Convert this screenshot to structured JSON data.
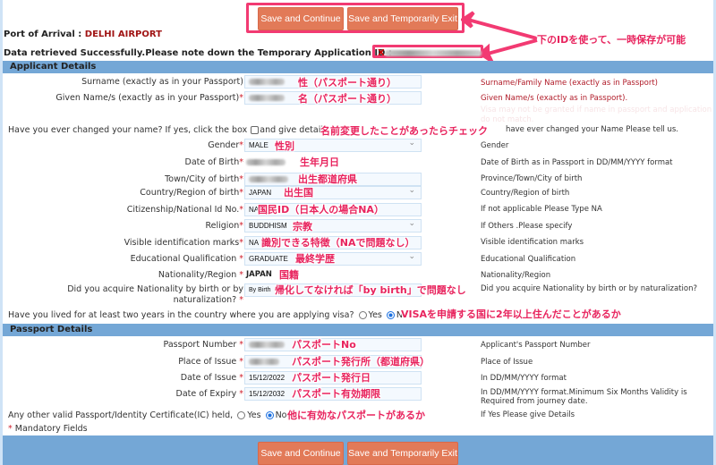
{
  "top_buttons": {
    "save_continue": "Save and Continue",
    "save_exit": "Save and Temporarily Exit"
  },
  "header": {
    "port_label": "Port of Arrival : ",
    "port_value": "DELHI AIRPORT",
    "retrieved_text": "Data retrieved Successfully.Please note down the Temporary Application ID : ",
    "app_id_prefix": "X"
  },
  "annotations": {
    "id_note": "下のIDを使って、一時保存が可能",
    "surname": "性（パスポート通り）",
    "given": "名（パスポート通り）",
    "name_change": "名前変更したことがあったらチェック",
    "gender": "性別",
    "dob": "生年月日",
    "town": "出生都道府県",
    "country": "出生国",
    "national_id": "国民ID（日本人の場合NA）",
    "religion": "宗教",
    "marks": "識別できる特徴（NAで問題なし）",
    "education": "最終学歴",
    "nationality": "国籍",
    "acquire": "帰化してなければ「by birth」で問題なし",
    "lived": "VISAを申請する国に2年以上住んだことがあるか",
    "passport_no": "パスポートNo",
    "place_issue": "パスポート発行所（都道府県）",
    "date_issue": "パスポート発行日",
    "date_expiry": "パスポート有効期限",
    "other_passport": "他に有効なパスポートがあるか"
  },
  "applicant": {
    "title": "Applicant Details",
    "surname": {
      "label": "Surname (exactly as in your Passport)",
      "hint": "Surname/Family Name (exactly as in Passport)"
    },
    "given": {
      "label": "Given Name/s (exactly as in your Passport)",
      "hint": "Given Name/s (exactly as in Passport).",
      "hint2": "Visa may not be granted if name in passport and application",
      "hint3": "do not match."
    },
    "name_change": {
      "label": "Have you ever changed your name? If yes, click the box",
      "after": "and give details",
      "hint": "have ever changed your Name Please tell us."
    },
    "gender": {
      "label": "Gender",
      "value": "MALE",
      "hint": "Gender"
    },
    "dob": {
      "label": "Date of Birth",
      "hint": "Date of Birth as in Passport in DD/MM/YYYY format"
    },
    "town": {
      "label": "Town/City of birth",
      "hint": "Province/Town/City of birth"
    },
    "country": {
      "label": "Country/Region of birth",
      "value": "JAPAN",
      "hint": "Country/Region of birth"
    },
    "national_id": {
      "label": "Citizenship/National Id No.",
      "value": "NA",
      "hint": "If not applicable Please Type NA"
    },
    "religion": {
      "label": "Religion",
      "value": "BUDDHISM",
      "hint": "If Others .Please specify"
    },
    "marks": {
      "label": "Visible identification marks",
      "value": "NA",
      "hint": "Visible identification marks"
    },
    "education": {
      "label": "Educational Qualification ",
      "value": "GRADUATE",
      "hint": "Educational Qualification"
    },
    "nationality": {
      "label": "Nationality/Region ",
      "value": "JAPAN",
      "hint": "Nationality/Region"
    },
    "acquire": {
      "label1": "Did you acquire Nationality by birth or by",
      "label2": "naturalization? ",
      "value": "By Birth",
      "hint": "Did you acquire Nationality by birth or by naturalization?"
    },
    "lived": {
      "label": "Have you lived for at least two years in the country where you are applying visa?",
      "yes": "Yes",
      "no": "No",
      "selected": "No"
    }
  },
  "passport": {
    "title": "Passport Details",
    "number": {
      "label": "Passport Number ",
      "hint": "Applicant's Passport Number"
    },
    "place": {
      "label": "Place of Issue ",
      "hint": "Place of Issue"
    },
    "issue": {
      "label": "Date of Issue ",
      "value": "15/12/2022",
      "hint": "In DD/MM/YYYY format"
    },
    "expiry": {
      "label": "Date of Expiry ",
      "value": "15/12/2032",
      "hint1": "In DD/MM/YYYY format.Minimum Six Months Validity is",
      "hint2": "Required from journey date."
    },
    "other": {
      "label": "Any other valid Passport/Identity Certificate(IC) held,",
      "yes": "Yes",
      "no": "No",
      "selected": "No",
      "hint": "If Yes Please give Details"
    },
    "mandatory": "Mandatory Fields"
  },
  "required_mark": "*",
  "bottom_buttons": {
    "save_continue": "Save and Continue",
    "save_exit": "Save and Temporarily Exit"
  }
}
